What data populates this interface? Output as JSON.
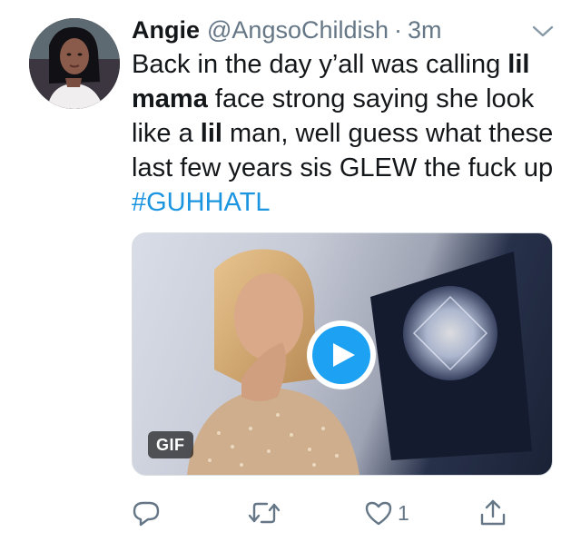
{
  "tweet": {
    "author_name": "Angie",
    "author_handle": "@AngsoChildish",
    "separator": "·",
    "timestamp": "3m",
    "text_parts": {
      "p1": "Back in the day y’all was calling ",
      "b1": "lil mama",
      "p2": " face strong saying she look like a ",
      "b2": "lil",
      "p3": " man, well guess what these last few years sis GLEW the fuck up"
    },
    "hashtag": "#GUHHATL",
    "media": {
      "badge": "GIF"
    },
    "actions": {
      "like_count": "1"
    }
  },
  "icons": {
    "caret": "chevron-down-icon",
    "reply": "reply-icon",
    "retweet": "retweet-icon",
    "like": "heart-icon",
    "share": "share-icon",
    "play": "play-icon"
  },
  "colors": {
    "link": "#1b95e0",
    "play_button": "#1da1f2",
    "secondary_text": "#657786",
    "icon": "#657786"
  }
}
